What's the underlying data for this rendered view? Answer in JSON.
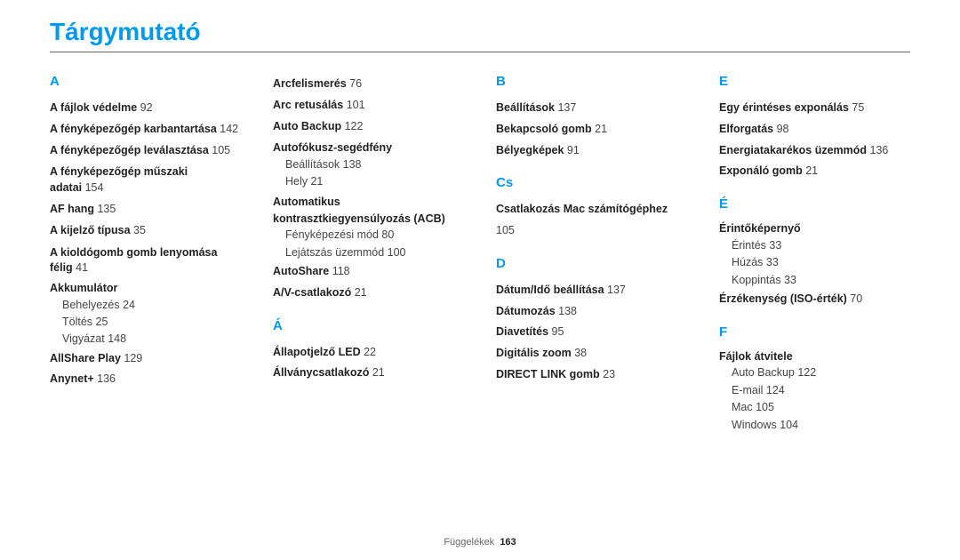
{
  "title": "Tárgymutató",
  "footer": {
    "label": "Függelékek",
    "page": "163"
  },
  "columns": [
    [
      {
        "type": "letter",
        "text": "A"
      },
      {
        "type": "entry",
        "text": "A fájlok védelme",
        "page": "92"
      },
      {
        "type": "entry",
        "text": "A fényképezőgép karbantartása",
        "page": "142"
      },
      {
        "type": "entry",
        "text": "A fényképezőgép leválasztása",
        "page": "105"
      },
      {
        "type": "entry2",
        "l1": "A fényképezőgép műszaki",
        "l2": "adatai",
        "page": "154"
      },
      {
        "type": "entry",
        "text": "AF hang",
        "page": "135"
      },
      {
        "type": "entry",
        "text": "A kijelző típusa",
        "page": "35"
      },
      {
        "type": "entry2",
        "l1": "A kioldógomb gomb lenyomása",
        "l2": "félig",
        "page": "41"
      },
      {
        "type": "subhead",
        "text": "Akkumulátor"
      },
      {
        "type": "sub",
        "text": "Behelyezés",
        "page": "24"
      },
      {
        "type": "sub",
        "text": "Töltés",
        "page": "25"
      },
      {
        "type": "sub",
        "text": "Vigyázat",
        "page": "148"
      },
      {
        "type": "entry",
        "text": "AllShare Play",
        "page": "129"
      },
      {
        "type": "entry",
        "text": "Anynet+",
        "page": "136"
      }
    ],
    [
      {
        "type": "entry",
        "text": "Arcfelismerés",
        "page": "76"
      },
      {
        "type": "entry",
        "text": "Arc retusálás",
        "page": "101"
      },
      {
        "type": "entry",
        "text": "Auto Backup",
        "page": "122"
      },
      {
        "type": "subhead",
        "text": "Autofókusz-segédfény"
      },
      {
        "type": "sub",
        "text": "Beállítások",
        "page": "138"
      },
      {
        "type": "sub",
        "text": "Hely",
        "page": "21"
      },
      {
        "type": "subhead2",
        "l1": "Automatikus",
        "l2": "kontrasztkiegyensúlyozás (ACB)"
      },
      {
        "type": "sub",
        "text": "Fényképezési mód",
        "page": "80"
      },
      {
        "type": "sub",
        "text": "Lejátszás üzemmód",
        "page": "100"
      },
      {
        "type": "entry",
        "text": "AutoShare",
        "page": "118"
      },
      {
        "type": "entry",
        "text": "A/V-csatlakozó",
        "page": "21"
      },
      {
        "type": "letter",
        "text": "Á"
      },
      {
        "type": "entry",
        "text": "Állapotjelző LED",
        "page": "22"
      },
      {
        "type": "entry",
        "text": "Állványcsatlakozó",
        "page": "21"
      }
    ],
    [
      {
        "type": "letter",
        "text": "B"
      },
      {
        "type": "entry",
        "text": "Beállítások",
        "page": "137"
      },
      {
        "type": "entry",
        "text": "Bekapcsoló gomb",
        "page": "21"
      },
      {
        "type": "entry",
        "text": "Bélyegképek",
        "page": "91"
      },
      {
        "type": "letter",
        "text": "Cs"
      },
      {
        "type": "entry",
        "text": "Csatlakozás Mac számítógéphez",
        "page": "105"
      },
      {
        "type": "letter",
        "text": "D"
      },
      {
        "type": "entry",
        "text": "Dátum/Idő beállítása",
        "page": "137"
      },
      {
        "type": "entry",
        "text": "Dátumozás",
        "page": "138"
      },
      {
        "type": "entry",
        "text": "Diavetítés",
        "page": "95"
      },
      {
        "type": "entry",
        "text": "Digitális zoom",
        "page": "38"
      },
      {
        "type": "entry",
        "text": "DIRECT LINK gomb",
        "page": "23"
      }
    ],
    [
      {
        "type": "letter",
        "text": "E"
      },
      {
        "type": "entry",
        "text": "Egy érintéses exponálás",
        "page": "75"
      },
      {
        "type": "entry",
        "text": "Elforgatás",
        "page": "98"
      },
      {
        "type": "entry",
        "text": "Energiatakarékos üzemmód",
        "page": "136"
      },
      {
        "type": "entry",
        "text": "Exponáló gomb",
        "page": "21"
      },
      {
        "type": "letter",
        "text": "É"
      },
      {
        "type": "subhead",
        "text": "Érintőképernyő"
      },
      {
        "type": "sub",
        "text": "Érintés",
        "page": "33"
      },
      {
        "type": "sub",
        "text": "Húzás",
        "page": "33"
      },
      {
        "type": "sub",
        "text": "Koppintás",
        "page": "33"
      },
      {
        "type": "entry",
        "text": "Érzékenység (ISO-érték)",
        "page": "70"
      },
      {
        "type": "letter",
        "text": "F"
      },
      {
        "type": "subhead",
        "text": "Fájlok átvitele"
      },
      {
        "type": "sub",
        "text": "Auto Backup",
        "page": "122"
      },
      {
        "type": "sub",
        "text": "E-mail",
        "page": "124"
      },
      {
        "type": "sub",
        "text": "Mac",
        "page": "105"
      },
      {
        "type": "sub",
        "text": "Windows",
        "page": "104"
      }
    ]
  ]
}
